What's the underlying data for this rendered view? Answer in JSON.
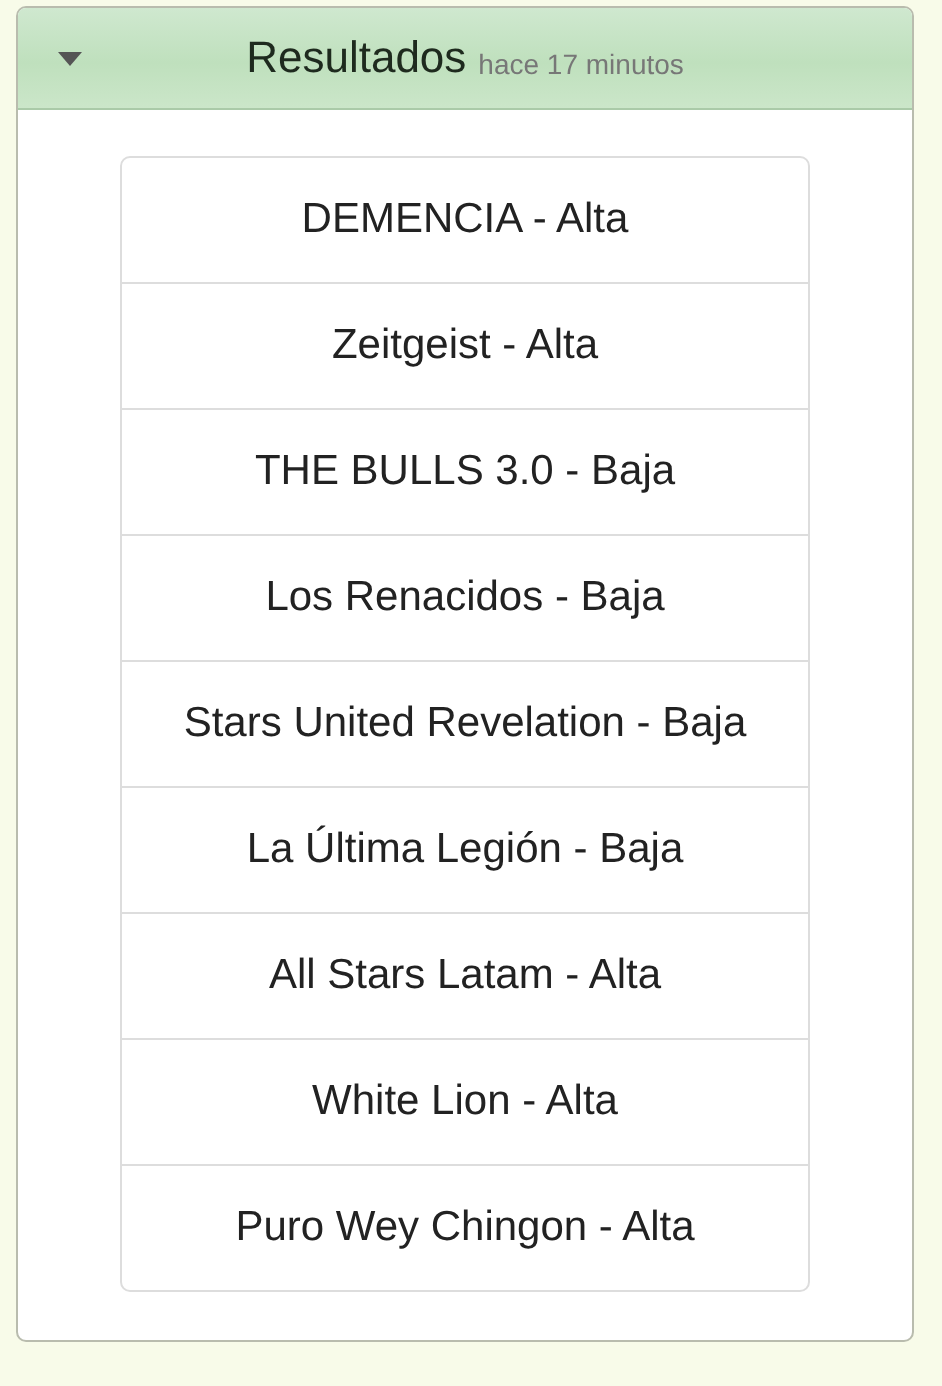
{
  "panel": {
    "title": "Resultados",
    "subtitle": "hace 17 minutos",
    "expanded": true
  },
  "results": [
    {
      "label": "DEMENCIA - Alta"
    },
    {
      "label": "Zeitgeist - Alta"
    },
    {
      "label": "THE BULLS 3.0 - Baja"
    },
    {
      "label": "Los Renacidos - Baja"
    },
    {
      "label": "Stars United Revelation - Baja"
    },
    {
      "label": "La Última Legión - Baja"
    },
    {
      "label": "All Stars Latam - Alta"
    },
    {
      "label": "White Lion - Alta"
    },
    {
      "label": "Puro Wey Chingon - Alta"
    }
  ]
}
